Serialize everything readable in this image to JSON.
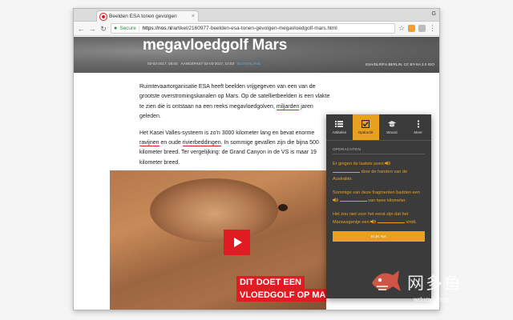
{
  "browser": {
    "tab_title": "Beelden ESA tonen gevolgen",
    "tab_close": "×",
    "user_badge": "G",
    "url_secure_label": "Secure",
    "url_host": "https://nos.nl",
    "url_path": "/artikel/2160977-beelden-esa-tonen-gevolgen-megavloedgolf-mars.html"
  },
  "hero": {
    "title": "megavloedgolf Mars",
    "meta_date": "03-03-2017, 08:00",
    "meta_updated": "AANGEPAST 03-03-2017, 10:03",
    "meta_link": "BUITENLAND",
    "credit": "ESA/DLR/FU BERLIN, CC BY-SA 3.0 IGO"
  },
  "article": {
    "p1_before": "Ruimtevaartorganisatie ESA heeft beelden vrijgegeven van een van de grootste overstromingskanalen op Mars. Op de satellietbeelden is een vlakte te zien die is ontstaan na een reeks megavloedgolven, ",
    "p1_link": "miljarden",
    "p1_after": " jaren geleden.",
    "p2_before": "Het Kasei Valles-systeem is zo'n 3000 kilometer lang en bevat enorme ",
    "p2_link1": "ravijnen",
    "p2_mid": " en oude ",
    "p2_link2": "rivierbeddingen",
    "p2_after": ". In sommige gevallen zijn die bijna 500 kilometer breed. Ter vergelijking: de Grand Canyon in de VS is maar 19 kilometer breed."
  },
  "video": {
    "caption_line1": "DIT DOET EEN",
    "caption_line2": "VLOEDGOLF OP MARS"
  },
  "panel": {
    "tabs": [
      {
        "label": "Artikelen",
        "icon": "list-icon"
      },
      {
        "label": "Opdracht",
        "icon": "checkbox-icon"
      },
      {
        "label": "Woord",
        "icon": "graduation-cap-icon"
      },
      {
        "label": "Meer",
        "icon": "more-vertical-icon"
      }
    ],
    "active_tab": "Opdracht",
    "section_title": "OPDRACHTEN",
    "q1_a": "Er gingen de laatste jaren",
    "q1_b": "door de handen van de Australiër.",
    "q2_a": "Sommige van deze fragmenten badden een",
    "q2_b": "van twee kilometer.",
    "q3_a": "Het zou niet voor het eerst zijn dat het Marswagentje een",
    "q3_b": "vindt.",
    "button_label": "KIJK NA"
  },
  "colors": {
    "accent": "#e8a020",
    "brand_red": "#e01b22",
    "panel_bg": "#3b3b3b"
  },
  "watermark": {
    "text": "网多鱼",
    "url": "wduoyu.com"
  }
}
